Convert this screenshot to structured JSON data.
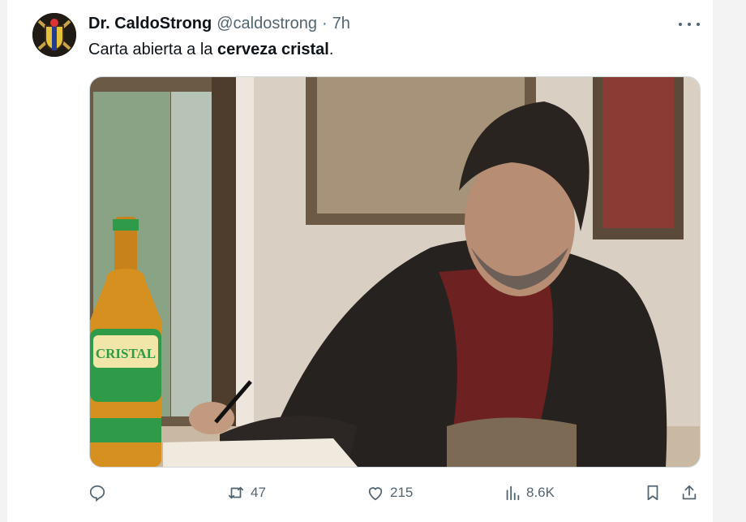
{
  "tweet": {
    "author_name": "Dr. CaldoStrong",
    "handle": "@caldostrong",
    "separator": "·",
    "time": "7h",
    "text_before": "Carta abierta a la ",
    "text_bold": "cerveza cristal",
    "text_after": ".",
    "image": {
      "bottle_label": "CRISTAL",
      "description_icons": [
        "beer-bottle",
        "writer-at-desk"
      ]
    }
  },
  "actions": {
    "reply_count": "",
    "retweet_count": "47",
    "like_count": "215",
    "views_count": "8.6K"
  },
  "icons": {
    "reply": "reply-icon",
    "retweet": "retweet-icon",
    "like": "heart-icon",
    "views": "views-icon",
    "bookmark": "bookmark-icon",
    "share": "share-icon",
    "more": "more-icon"
  },
  "colors": {
    "text": "#0f1419",
    "muted": "#536471",
    "border": "#cfd9de"
  }
}
